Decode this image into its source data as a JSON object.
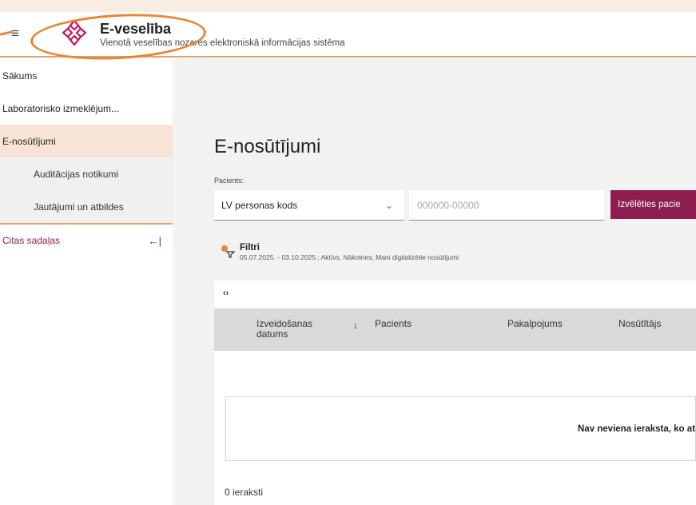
{
  "header": {
    "menu_icon": "hamburger-icon",
    "logo_icon": "e-veseliba-logo-icon",
    "title": "E-veselība",
    "subtitle": "Vienotā veselības nozares elektroniskā informācijas sistēma",
    "accent_color": "#e9852e"
  },
  "sidebar": {
    "items": [
      {
        "label": "Sākums"
      },
      {
        "label": "Laboratorisko izmeklējum..."
      },
      {
        "label": "E-nosūtījumi"
      }
    ],
    "sub_items": [
      {
        "label": "Auditācijas notikumi"
      },
      {
        "label": "Jautājumi un atbildes"
      }
    ],
    "other_sections": "Citas sadaļas",
    "collapse_icon": "collapse-left-icon"
  },
  "main": {
    "page_title": "E-nosūtījumi",
    "patient_label": "Pacients:",
    "id_type_select": "LV personas kods",
    "code_placeholder": "000000-00000",
    "choose_button": "Izvēlēties pacie",
    "filter": {
      "title": "Filtri",
      "description": "05.07.2025. - 03.10.2025.; Aktīvs, Nākotnes; Mani digitalizētie nosūtījumi"
    },
    "scroll_arrows": "‹›",
    "table": {
      "columns": [
        "Izveidošanas datums",
        "Pacients",
        "Pakalpojums",
        "Nosūtītājs"
      ],
      "sort_icon": "↓",
      "empty_message": "Nav neviena ieraksta, ko at",
      "count": "0 ieraksti"
    }
  },
  "colors": {
    "brand": "#8c1d4e",
    "accent": "#e8a06e",
    "active_bg": "#f8e4d6"
  }
}
